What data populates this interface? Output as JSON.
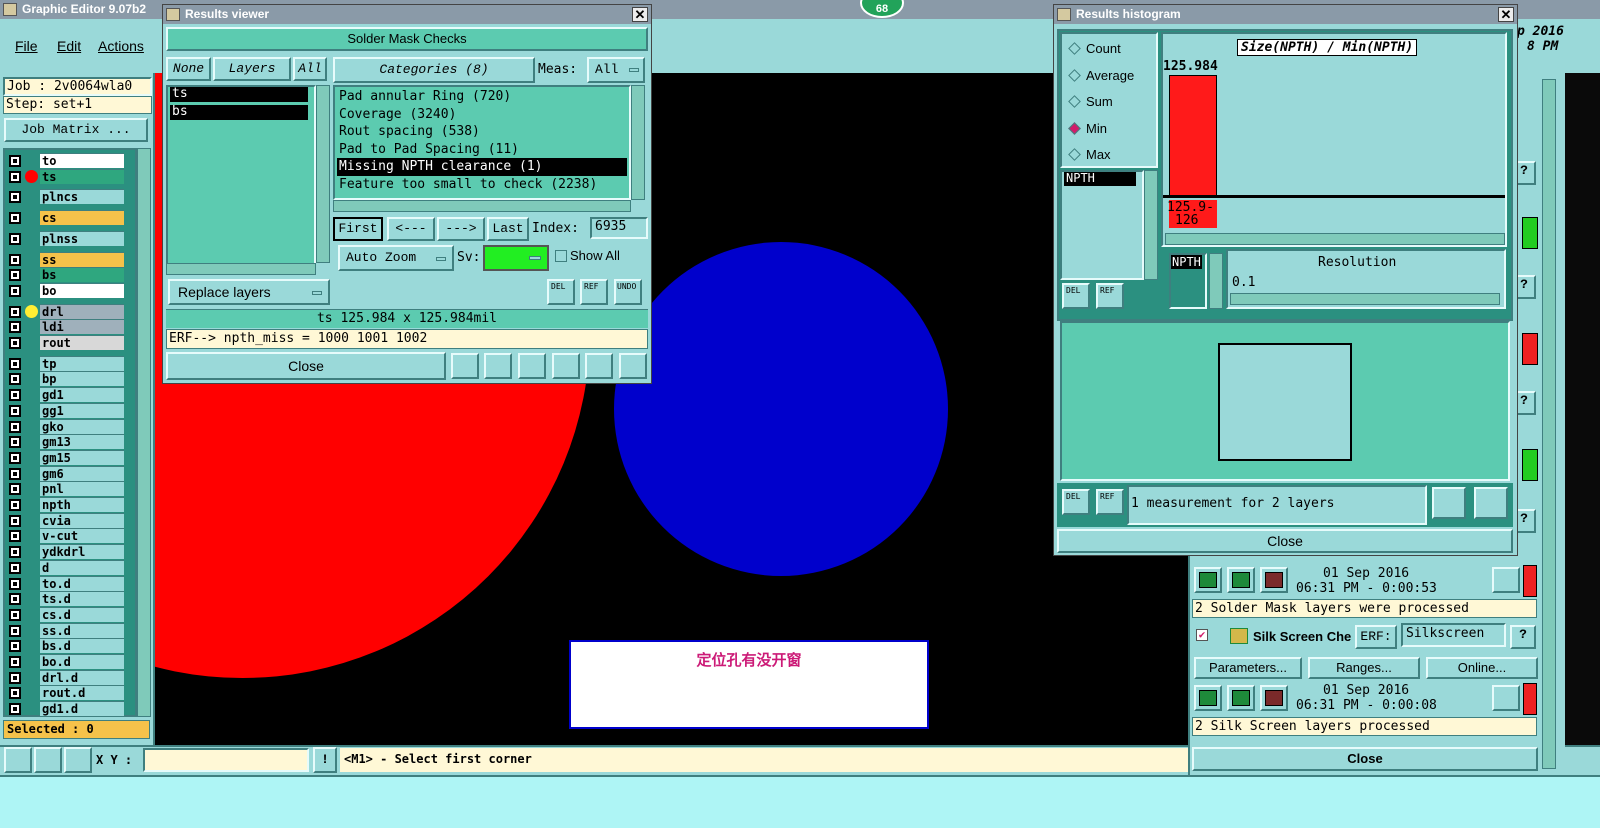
{
  "main_window": {
    "title": "Graphic Editor 9.07b2 (00",
    "menu": [
      "File",
      "Edit",
      "Actions"
    ],
    "job": "Job : 2v0064wla0",
    "step": "Step: set+1",
    "job_matrix": "Job Matrix ...",
    "selected": "Selected : 0"
  },
  "layers": [
    {
      "name": "to",
      "color": "#ffffff",
      "dot": ""
    },
    {
      "name": "ts",
      "color": "#2fa77f",
      "dot": "#ff0000"
    },
    {
      "name": "plncs",
      "color": "#9ad9d9",
      "dot": ""
    },
    {
      "name": "cs",
      "color": "#f5c24a",
      "dot": ""
    },
    {
      "name": "plnss",
      "color": "#9ad9d9",
      "dot": ""
    },
    {
      "name": "ss",
      "color": "#f5c24a",
      "dot": ""
    },
    {
      "name": "bs",
      "color": "#2fa77f",
      "dot": ""
    },
    {
      "name": "bo",
      "color": "#ffffff",
      "dot": ""
    },
    {
      "name": "drl",
      "color": "#9fb0bb",
      "dot": "#ffee33"
    },
    {
      "name": "ldi",
      "color": "#9fb0bb",
      "dot": ""
    },
    {
      "name": "rout",
      "color": "#d8d8d8",
      "dot": ""
    },
    {
      "name": "tp",
      "color": "#9ad9d9",
      "dot": ""
    },
    {
      "name": "bp",
      "color": "#9ad9d9",
      "dot": ""
    },
    {
      "name": "gd1",
      "color": "#9ad9d9",
      "dot": ""
    },
    {
      "name": "gg1",
      "color": "#9ad9d9",
      "dot": ""
    },
    {
      "name": "gko",
      "color": "#9ad9d9",
      "dot": ""
    },
    {
      "name": "gm13",
      "color": "#9ad9d9",
      "dot": ""
    },
    {
      "name": "gm15",
      "color": "#9ad9d9",
      "dot": ""
    },
    {
      "name": "gm6",
      "color": "#9ad9d9",
      "dot": ""
    },
    {
      "name": "pnl",
      "color": "#9ad9d9",
      "dot": ""
    },
    {
      "name": "npth",
      "color": "#9ad9d9",
      "dot": ""
    },
    {
      "name": "cvia",
      "color": "#9ad9d9",
      "dot": ""
    },
    {
      "name": "v-cut",
      "color": "#9ad9d9",
      "dot": ""
    },
    {
      "name": "ydkdrl",
      "color": "#9ad9d9",
      "dot": ""
    },
    {
      "name": "d",
      "color": "#9ad9d9",
      "dot": ""
    },
    {
      "name": "to.d",
      "color": "#9ad9d9",
      "dot": ""
    },
    {
      "name": "ts.d",
      "color": "#9ad9d9",
      "dot": ""
    },
    {
      "name": "cs.d",
      "color": "#9ad9d9",
      "dot": ""
    },
    {
      "name": "ss.d",
      "color": "#9ad9d9",
      "dot": ""
    },
    {
      "name": "bs.d",
      "color": "#9ad9d9",
      "dot": ""
    },
    {
      "name": "bo.d",
      "color": "#9ad9d9",
      "dot": ""
    },
    {
      "name": "drl.d",
      "color": "#9ad9d9",
      "dot": ""
    },
    {
      "name": "rout.d",
      "color": "#9ad9d9",
      "dot": ""
    },
    {
      "name": "gd1.d",
      "color": "#9ad9d9",
      "dot": ""
    }
  ],
  "canvas": {
    "note_text": "定位孔有没开窗",
    "badge": "68"
  },
  "bottom_bar": {
    "xy_label": "X Y :",
    "xy_value": "",
    "prompt": "<M1> - Select first corner"
  },
  "results_viewer": {
    "title": "Results viewer",
    "header": "Solder Mask Checks",
    "none": "None",
    "layers_label": "Layers",
    "all": "All",
    "layer_items": [
      "ts",
      "bs"
    ],
    "categories_label": "Categories (8)",
    "meas_label": "Meas:",
    "meas_value": "All",
    "categories": [
      "Pad annular Ring (720)",
      "Coverage (3240)",
      "Rout spacing (538)",
      "Pad to Pad Spacing (11)",
      "Missing NPTH clearance (1)",
      "Feature too small to check (2238)"
    ],
    "selected_category": "Missing NPTH clearance (1)",
    "first": "First",
    "prev": "<---",
    "next": "--->",
    "last": "Last",
    "index_label": "Index:",
    "index_value": "6935",
    "auto_zoom": "Auto Zoom",
    "sv_label": "Sv:",
    "show_all": "Show All",
    "replace_layers": "Replace layers",
    "measure": "ts 125.984 x 125.984mil",
    "erf": "ERF--> npth_miss = 1000 1001 1002",
    "close": "Close",
    "del": "DEL",
    "ref": "REF",
    "undo": "UNDO"
  },
  "histogram": {
    "title": "Results histogram",
    "options": [
      "Count",
      "Average",
      "Sum",
      "Min",
      "Max"
    ],
    "selected_option": "Min",
    "list_item": "NPTH",
    "chart_title": "Size(NPTH) / Min(NPTH)",
    "bar_label": "125.984",
    "bar_color": "#ff1a1a",
    "axis_label": "125.9-\n126",
    "resolution_label": "Resolution",
    "resolution_value": "0.1",
    "npth_tag": "NPTH",
    "del": "DEL",
    "ref": "REF",
    "status": "1 measurement for 2 layers",
    "close": "Close"
  },
  "right_panel": {
    "header_date": "p 2016",
    "header_time": "8 PM",
    "sm_date": "01 Sep 2016",
    "sm_time": "06:31 PM - 0:00:53",
    "sm_status": "2 Solder Mask layers were processed",
    "ss_name": "Silk Screen Che",
    "ss_erf_label": "ERF:",
    "ss_erf_value": "Silkscreen",
    "q": "?",
    "params": "Parameters...",
    "ranges": "Ranges...",
    "online": "Online...",
    "ss_date": "01 Sep 2016",
    "ss_time": "06:31 PM - 0:00:08",
    "ss_status": "2 Silk Screen layers processed",
    "close": "Close"
  },
  "colors": {
    "teal": "#9ad9d9",
    "green": "#5ccbb0",
    "red": "#ff0000",
    "blue": "#0000cc"
  }
}
